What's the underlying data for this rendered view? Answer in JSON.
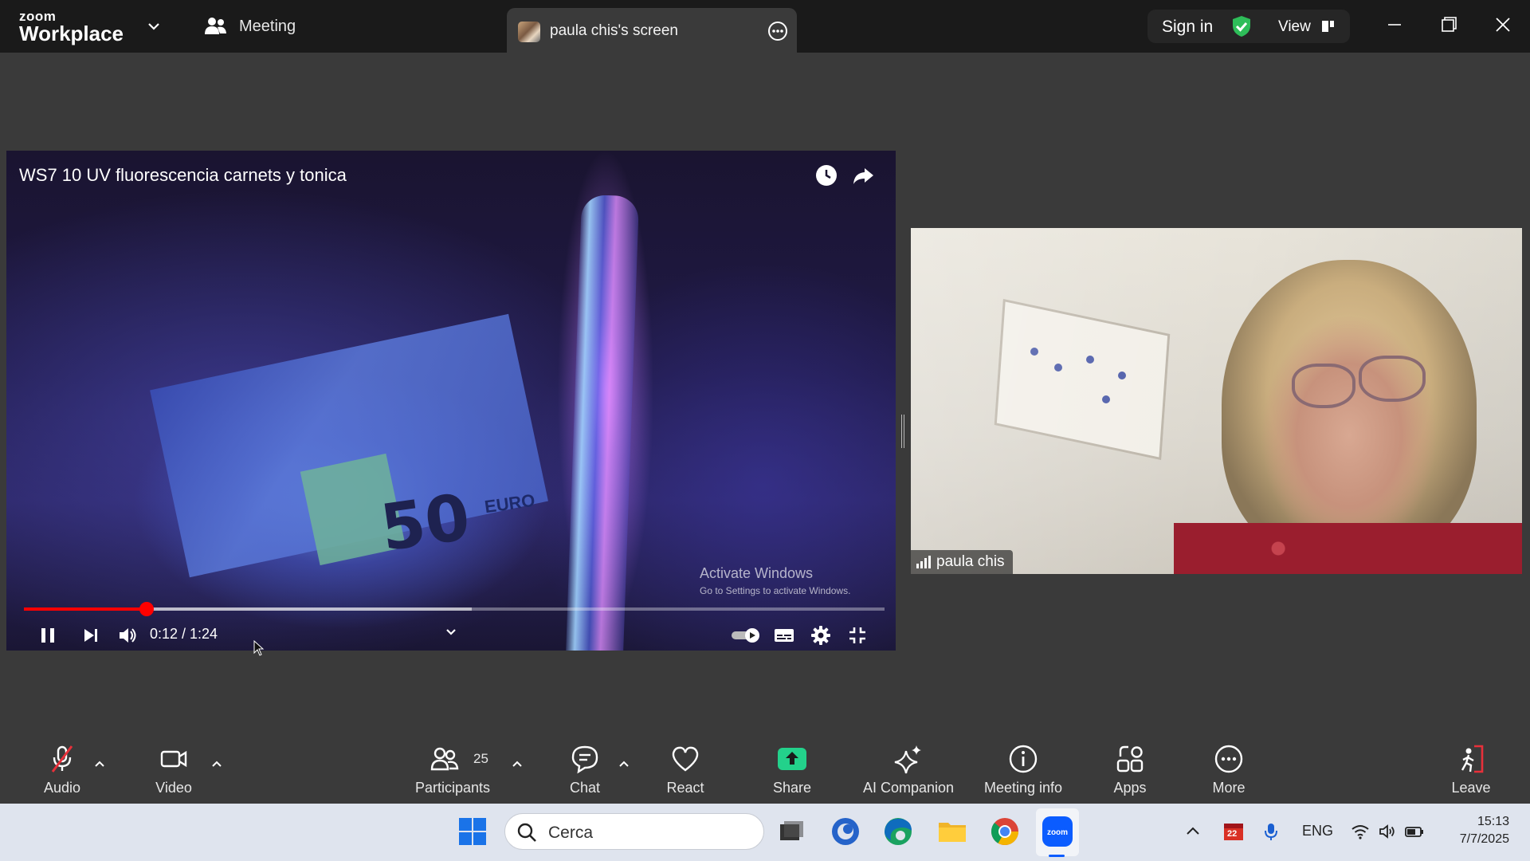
{
  "titlebar": {
    "logo_top": "zoom",
    "logo_bottom": "Workplace",
    "meeting_label": "Meeting",
    "share_tab_label": "paula chis's screen",
    "sign_in": "Sign in",
    "view": "View"
  },
  "video": {
    "title": "WS7 10 UV fluorescencia carnets y tonica",
    "time": "0:12 / 1:24",
    "played_fraction": 0.143,
    "loaded_fraction": 0.52,
    "activate_line1": "Activate Windows",
    "activate_line2": "Go to Settings to activate Windows.",
    "note_number": "50",
    "note_text": "EURO"
  },
  "participant": {
    "name": "paula chis"
  },
  "toolbar": {
    "audio": "Audio",
    "video": "Video",
    "participants": "Participants",
    "participants_count": "25",
    "chat": "Chat",
    "react": "React",
    "share": "Share",
    "ai_companion": "AI Companion",
    "meeting_info": "Meeting info",
    "apps": "Apps",
    "more": "More",
    "leave": "Leave"
  },
  "taskbar": {
    "search_placeholder": "Cerca",
    "language": "ENG",
    "time": "15:13",
    "date": "7/7/2025",
    "calendar_badge": "22"
  },
  "colors": {
    "titlebar_bg": "#1a1a1a",
    "app_bg": "#3a3a3a",
    "share_green": "#23d18b",
    "shield_green": "#2ebd59",
    "progress_red": "#ff0000",
    "leave_red": "#e8303a"
  }
}
